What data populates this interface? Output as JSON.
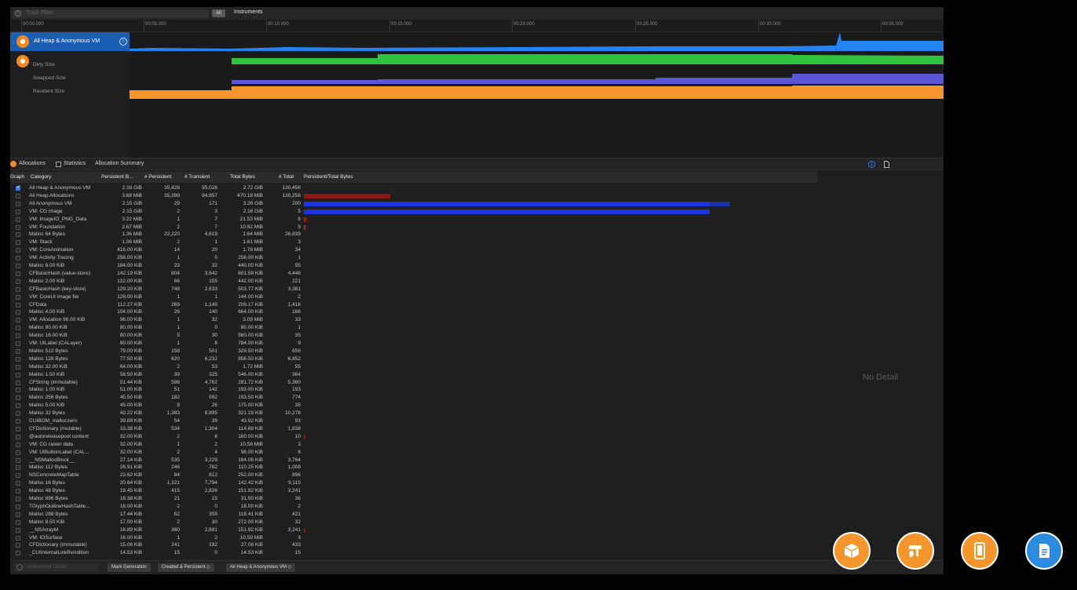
{
  "filter": {
    "placeholder": "Track Filter",
    "all_label": "All",
    "instruments_label": "Instruments"
  },
  "ruler": [
    "00:00.000",
    "00:05.000",
    "00:10.000",
    "00:15.000",
    "00:20.000",
    "00:25.000",
    "00:30.000",
    "00:35.000"
  ],
  "tracks": {
    "selected": "All Heap & Anonymous VM",
    "labels": [
      "Dirty Size",
      "Swapped Size",
      "Resident Size"
    ]
  },
  "tabs": {
    "allocations": "Allocations",
    "statistics": "Statistics",
    "summary": "Allocation Summary"
  },
  "columns": [
    "Graph",
    "Category",
    "Persistent B...",
    "# Persistent",
    "# Transient",
    "Total Bytes",
    "# Total",
    "Persistent/Total Bytes"
  ],
  "rows": [
    {
      "cat": "All Heap & Anonymous VM",
      "pb": "2.16 GiB",
      "np": "35,428",
      "nt": "95,028",
      "tb": "2.72 GiB",
      "tot": "130,456",
      "checked": true
    },
    {
      "cat": "All Heap Allocations",
      "pb": "3.68 MiB",
      "np": "35,399",
      "nt": "94,857",
      "tb": "470.18 MiB",
      "tot": "130,256"
    },
    {
      "cat": "All Anonymous VM",
      "pb": "2.15 GiB",
      "np": "29",
      "nt": "171",
      "tb": "3.26 GiB",
      "tot": "200"
    },
    {
      "cat": "VM: CG image",
      "pb": "2.15 GiB",
      "np": "2",
      "nt": "3",
      "tb": "2.16 GiB",
      "tot": "5"
    },
    {
      "cat": "VM: ImageIO_PNG_Data",
      "pb": "3.22 MiB",
      "np": "1",
      "nt": "7",
      "tb": "21.53 MiB",
      "tot": "8"
    },
    {
      "cat": "VM: Foundation",
      "pb": "2.67 MiB",
      "np": "2",
      "nt": "7",
      "tb": "10.92 MiB",
      "tot": "9"
    },
    {
      "cat": "Malloc 64 Bytes",
      "pb": "1.36 MiB",
      "np": "22,220",
      "nt": "4,619",
      "tb": "1.64 MiB",
      "tot": "26,839"
    },
    {
      "cat": "VM: Stack",
      "pb": "1.06 MiB",
      "np": "2",
      "nt": "1",
      "tb": "1.61 MiB",
      "tot": "3"
    },
    {
      "cat": "VM: CoreAnimation",
      "pb": "416.00 KiB",
      "np": "14",
      "nt": "20",
      "tb": "1.78 MiB",
      "tot": "34"
    },
    {
      "cat": "VM: Activity Tracing",
      "pb": "256.00 KiB",
      "np": "1",
      "nt": "0",
      "tb": "256.00 KiB",
      "tot": "1"
    },
    {
      "cat": "Malloc 8.00 KiB",
      "pb": "184.00 KiB",
      "np": "23",
      "nt": "32",
      "tb": "440.00 KiB",
      "tot": "55"
    },
    {
      "cat": "CFBasicHash (value-store)",
      "pb": "142.19 KiB",
      "np": "804",
      "nt": "3,642",
      "tb": "601.59 KiB",
      "tot": "4,446"
    },
    {
      "cat": "Malloc 2.00 KiB",
      "pb": "132.00 KiB",
      "np": "66",
      "nt": "155",
      "tb": "442.00 KiB",
      "tot": "221"
    },
    {
      "cat": "CFBasicHash (key-store)",
      "pb": "129.20 KiB",
      "np": "748",
      "nt": "2,633",
      "tb": "503.77 KiB",
      "tot": "3,381"
    },
    {
      "cat": "VM: CoreUI image file",
      "pb": "128.00 KiB",
      "np": "1",
      "nt": "1",
      "tb": "144.00 KiB",
      "tot": "2"
    },
    {
      "cat": "CFData",
      "pb": "112.27 KiB",
      "np": "269",
      "nt": "1,149",
      "tb": "209.17 KiB",
      "tot": "1,418"
    },
    {
      "cat": "Malloc 4.00 KiB",
      "pb": "104.00 KiB",
      "np": "26",
      "nt": "140",
      "tb": "664.00 KiB",
      "tot": "166"
    },
    {
      "cat": "VM: Allocation 96.00 KiB",
      "pb": "96.00 KiB",
      "np": "1",
      "nt": "32",
      "tb": "3.09 MiB",
      "tot": "33"
    },
    {
      "cat": "Malloc 80.00 KiB",
      "pb": "80.00 KiB",
      "np": "1",
      "nt": "0",
      "tb": "80.00 KiB",
      "tot": "1"
    },
    {
      "cat": "Malloc 16.00 KiB",
      "pb": "80.00 KiB",
      "np": "5",
      "nt": "30",
      "tb": "560.00 KiB",
      "tot": "35"
    },
    {
      "cat": "VM: UILabel (CALayer)",
      "pb": "80.00 KiB",
      "np": "1",
      "nt": "8",
      "tb": "784.00 KiB",
      "tot": "9"
    },
    {
      "cat": "Malloc 512 Bytes",
      "pb": "79.00 KiB",
      "np": "158",
      "nt": "501",
      "tb": "329.50 KiB",
      "tot": "659"
    },
    {
      "cat": "Malloc 128 Bytes",
      "pb": "77.50 KiB",
      "np": "620",
      "nt": "6,232",
      "tb": "856.50 KiB",
      "tot": "6,852"
    },
    {
      "cat": "Malloc 32.00 KiB",
      "pb": "64.00 KiB",
      "np": "2",
      "nt": "53",
      "tb": "1.72 MiB",
      "tot": "55"
    },
    {
      "cat": "Malloc 1.50 KiB",
      "pb": "58.50 KiB",
      "np": "39",
      "nt": "325",
      "tb": "546.00 KiB",
      "tot": "364"
    },
    {
      "cat": "CFString (immutable)",
      "pb": "51.44 KiB",
      "np": "598",
      "nt": "4,762",
      "tb": "281.72 KiB",
      "tot": "5,360"
    },
    {
      "cat": "Malloc 1.00 KiB",
      "pb": "51.00 KiB",
      "np": "51",
      "nt": "142",
      "tb": "193.00 KiB",
      "tot": "193"
    },
    {
      "cat": "Malloc 256 Bytes",
      "pb": "45.50 KiB",
      "np": "182",
      "nt": "592",
      "tb": "193.50 KiB",
      "tot": "774"
    },
    {
      "cat": "Malloc 5.00 KiB",
      "pb": "45.00 KiB",
      "np": "9",
      "nt": "26",
      "tb": "175.00 KiB",
      "tot": "35"
    },
    {
      "cat": "Malloc 32 Bytes",
      "pb": "43.22 KiB",
      "np": "1,383",
      "nt": "8,895",
      "tb": "321.19 KiB",
      "tot": "10,278"
    },
    {
      "cat": "CUIBOM_malloczero",
      "pb": "39.88 KiB",
      "np": "54",
      "nt": "39",
      "tb": "43.92 KiB",
      "tot": "93"
    },
    {
      "cat": "CFDictionary (mutable)",
      "pb": "33.38 KiB",
      "np": "534",
      "nt": "1,304",
      "tb": "114.88 KiB",
      "tot": "1,838"
    },
    {
      "cat": "@autoreleasepool content",
      "pb": "32.00 KiB",
      "np": "2",
      "nt": "8",
      "tb": "160.00 KiB",
      "tot": "10"
    },
    {
      "cat": "VM: CG raster data",
      "pb": "32.00 KiB",
      "np": "1",
      "nt": "2",
      "tb": "10.58 MiB",
      "tot": "3"
    },
    {
      "cat": "VM: UIButtonLabel (CAL...",
      "pb": "32.00 KiB",
      "np": "2",
      "nt": "4",
      "tb": "96.00 KiB",
      "tot": "6"
    },
    {
      "cat": "__NSMallocBlock__",
      "pb": "27.14 KiB",
      "np": "535",
      "nt": "3,229",
      "tb": "184.06 KiB",
      "tot": "3,764"
    },
    {
      "cat": "Malloc 112 Bytes",
      "pb": "26.91 KiB",
      "np": "246",
      "nt": "762",
      "tb": "110.25 KiB",
      "tot": "1,008"
    },
    {
      "cat": "NSConcreteMapTable",
      "pb": "23.62 KiB",
      "np": "84",
      "nt": "812",
      "tb": "252.00 KiB",
      "tot": "896"
    },
    {
      "cat": "Malloc 16 Bytes",
      "pb": "20.64 KiB",
      "np": "1,321",
      "nt": "7,794",
      "tb": "142.42 KiB",
      "tot": "9,115"
    },
    {
      "cat": "Malloc 48 Bytes",
      "pb": "19.45 KiB",
      "np": "415",
      "nt": "2,826",
      "tb": "151.92 KiB",
      "tot": "3,241"
    },
    {
      "cat": "Malloc 896 Bytes",
      "pb": "18.38 KiB",
      "np": "21",
      "nt": "15",
      "tb": "31.50 KiB",
      "tot": "36"
    },
    {
      "cat": "TGlyphOutlineHashTable...",
      "pb": "18.00 KiB",
      "np": "2",
      "nt": "0",
      "tb": "18.00 KiB",
      "tot": "2"
    },
    {
      "cat": "Malloc 288 Bytes",
      "pb": "17.44 KiB",
      "np": "62",
      "nt": "359",
      "tb": "118.41 KiB",
      "tot": "421"
    },
    {
      "cat": "Malloc 8.50 KiB",
      "pb": "17.00 KiB",
      "np": "2",
      "nt": "30",
      "tb": "272.00 KiB",
      "tot": "32"
    },
    {
      "cat": "__NSArrayM",
      "pb": "16.89 KiB",
      "np": "360",
      "nt": "2,881",
      "tb": "151.92 KiB",
      "tot": "3,241"
    },
    {
      "cat": "VM: IOSurface",
      "pb": "16.00 KiB",
      "np": "1",
      "nt": "2",
      "tb": "10.59 MiB",
      "tot": "3"
    },
    {
      "cat": "CFDictionary (immutable)",
      "pb": "15.06 KiB",
      "np": "241",
      "nt": "192",
      "tb": "27.06 KiB",
      "tot": "433"
    },
    {
      "cat": "_CUIInternalLinkRendition",
      "pb": "14.53 KiB",
      "np": "15",
      "nt": "0",
      "tb": "14.53 KiB",
      "tot": "15"
    }
  ],
  "detail": {
    "empty_label": "No Detail"
  },
  "bottom": {
    "filter_placeholder": "Instrument Detail",
    "mark_generation": "Mark Generation",
    "created_persistent": "Created & Persistent ◇",
    "heap_vm": "All Heap & Anonymous VM ◇"
  },
  "colors": {
    "dirty": "#2fc23c",
    "swapped": "#5a55d6",
    "resident": "#f5952b",
    "heap": "#2383f0",
    "persist_bar": "#1b33e0",
    "total_bar": "#8b1717"
  }
}
